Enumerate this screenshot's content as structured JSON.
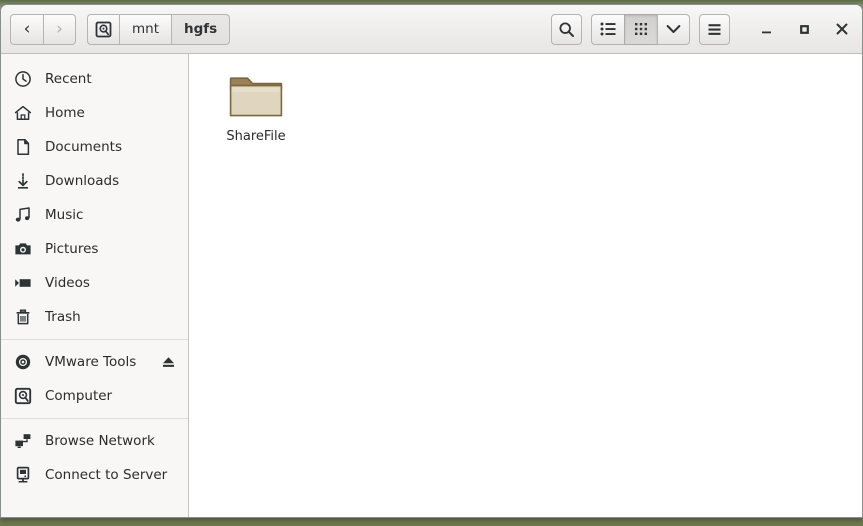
{
  "window": {
    "controls": {
      "minimize_label": "Minimize",
      "maximize_label": "Maximize",
      "close_label": "Close"
    }
  },
  "headerbar": {
    "nav": {
      "back_label": "Back",
      "forward_label": "Forward",
      "back_glyph": "‹",
      "forward_glyph": "›"
    },
    "breadcrumb": [
      {
        "label": "",
        "icon": "computer-drive-icon",
        "current": false
      },
      {
        "label": "mnt",
        "icon": "",
        "current": false
      },
      {
        "label": "hgfs",
        "icon": "",
        "current": true
      }
    ],
    "tools": {
      "search_label": "Search",
      "list_view_label": "List view",
      "grid_view_label": "Grid view",
      "view_dropdown_label": "View options",
      "menu_label": "Main menu",
      "active_view": "grid"
    }
  },
  "sidebar": {
    "items": [
      {
        "label": "Recent",
        "icon": "clock-icon",
        "type": "place",
        "eject": false
      },
      {
        "label": "Home",
        "icon": "home-icon",
        "type": "place",
        "eject": false
      },
      {
        "label": "Documents",
        "icon": "document-icon",
        "type": "place",
        "eject": false
      },
      {
        "label": "Downloads",
        "icon": "download-icon",
        "type": "place",
        "eject": false
      },
      {
        "label": "Music",
        "icon": "music-icon",
        "type": "place",
        "eject": false
      },
      {
        "label": "Pictures",
        "icon": "camera-icon",
        "type": "place",
        "eject": false
      },
      {
        "label": "Videos",
        "icon": "video-icon",
        "type": "place",
        "eject": false
      },
      {
        "label": "Trash",
        "icon": "trash-icon",
        "type": "place",
        "eject": false
      },
      {
        "label": "",
        "icon": "",
        "type": "separator",
        "eject": false
      },
      {
        "label": "VMware Tools",
        "icon": "disc-icon",
        "type": "device",
        "eject": true
      },
      {
        "label": "Computer",
        "icon": "computer-drive-icon",
        "type": "device",
        "eject": false
      },
      {
        "label": "",
        "icon": "",
        "type": "separator",
        "eject": false
      },
      {
        "label": "Browse Network",
        "icon": "network-icon",
        "type": "network",
        "eject": false
      },
      {
        "label": "Connect to Server",
        "icon": "server-icon",
        "type": "network",
        "eject": false
      }
    ]
  },
  "content": {
    "files": [
      {
        "name": "ShareFile",
        "icon": "folder-icon",
        "kind": "folder"
      }
    ]
  },
  "colors": {
    "folder_body": "#e2d8c1",
    "folder_tab": "#8a7550",
    "folder_outline": "#7d6a47",
    "desktop": "#8e9774",
    "header_bg": "#efeeed",
    "sidebar_bg": "#f8f7f6",
    "content_bg": "#ffffff",
    "text": "#2b2b2b"
  }
}
